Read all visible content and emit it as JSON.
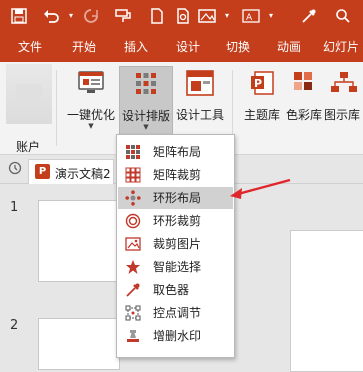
{
  "quick_access": {
    "icons": [
      "save-icon",
      "undo-icon",
      "redo-icon",
      "format-painter-icon",
      "file-icon",
      "print-preview-icon",
      "pictures-icon",
      "text-box-icon",
      "eyedropper-icon",
      "search-icon"
    ]
  },
  "tabs": [
    "文件",
    "开始",
    "插入",
    "设计",
    "切换",
    "动画",
    "幻灯片"
  ],
  "ribbon": {
    "account_label": "账户",
    "buttons": [
      {
        "label": "一键优化",
        "icon": "monitor-icon"
      },
      {
        "label": "设计排版",
        "icon": "grid-layout-icon"
      },
      {
        "label": "设计工具",
        "icon": "design-tools-icon"
      },
      {
        "label": "主题库",
        "icon": "theme-library-icon"
      },
      {
        "label": "色彩库",
        "icon": "color-library-icon"
      },
      {
        "label": "图示库",
        "icon": "diagram-library-icon"
      }
    ]
  },
  "document": {
    "tab_label": "演示文稿2",
    "app_icon_letter": "P",
    "slide_numbers": [
      "1",
      "2"
    ]
  },
  "dropdown_menu": {
    "items": [
      {
        "label": "矩阵布局",
        "icon": "matrix-layout-icon"
      },
      {
        "label": "矩阵裁剪",
        "icon": "matrix-crop-icon"
      },
      {
        "label": "环形布局",
        "icon": "circular-layout-icon"
      },
      {
        "label": "环形裁剪",
        "icon": "circular-crop-icon"
      },
      {
        "label": "裁剪图片",
        "icon": "crop-image-icon"
      },
      {
        "label": "智能选择",
        "icon": "smart-select-icon"
      },
      {
        "label": "取色器",
        "icon": "color-picker-icon"
      },
      {
        "label": "控点调节",
        "icon": "handle-adjust-icon"
      },
      {
        "label": "增删水印",
        "icon": "watermark-icon"
      }
    ],
    "highlighted": "环形布局"
  },
  "colors": {
    "brand": "#c43e1c",
    "menu_icon_red": "#c0392b",
    "arrow_red": "#e0262b"
  }
}
